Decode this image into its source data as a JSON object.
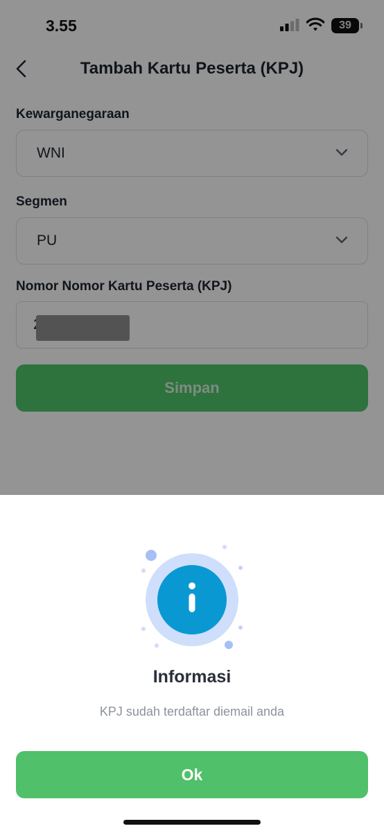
{
  "status_bar": {
    "time": "3.55",
    "battery": "39"
  },
  "header": {
    "title": "Tambah Kartu Peserta (KPJ)",
    "back_icon": "chevron-left-icon"
  },
  "form": {
    "citizenship": {
      "label": "Kewarganegaraan",
      "value": "WNI"
    },
    "segment": {
      "label": "Segmen",
      "value": "PU"
    },
    "card_number": {
      "label": "Nomor Nomor Kartu Peserta (KPJ)",
      "value": "2"
    },
    "save_label": "Simpan"
  },
  "dialog": {
    "icon": "info-icon",
    "title": "Informasi",
    "message": "KPJ sudah terdaftar diemail anda",
    "ok_label": "Ok"
  },
  "colors": {
    "primary_green": "#50c06a",
    "info_blue": "#0a98d3",
    "info_ring": "#cfdffb"
  }
}
